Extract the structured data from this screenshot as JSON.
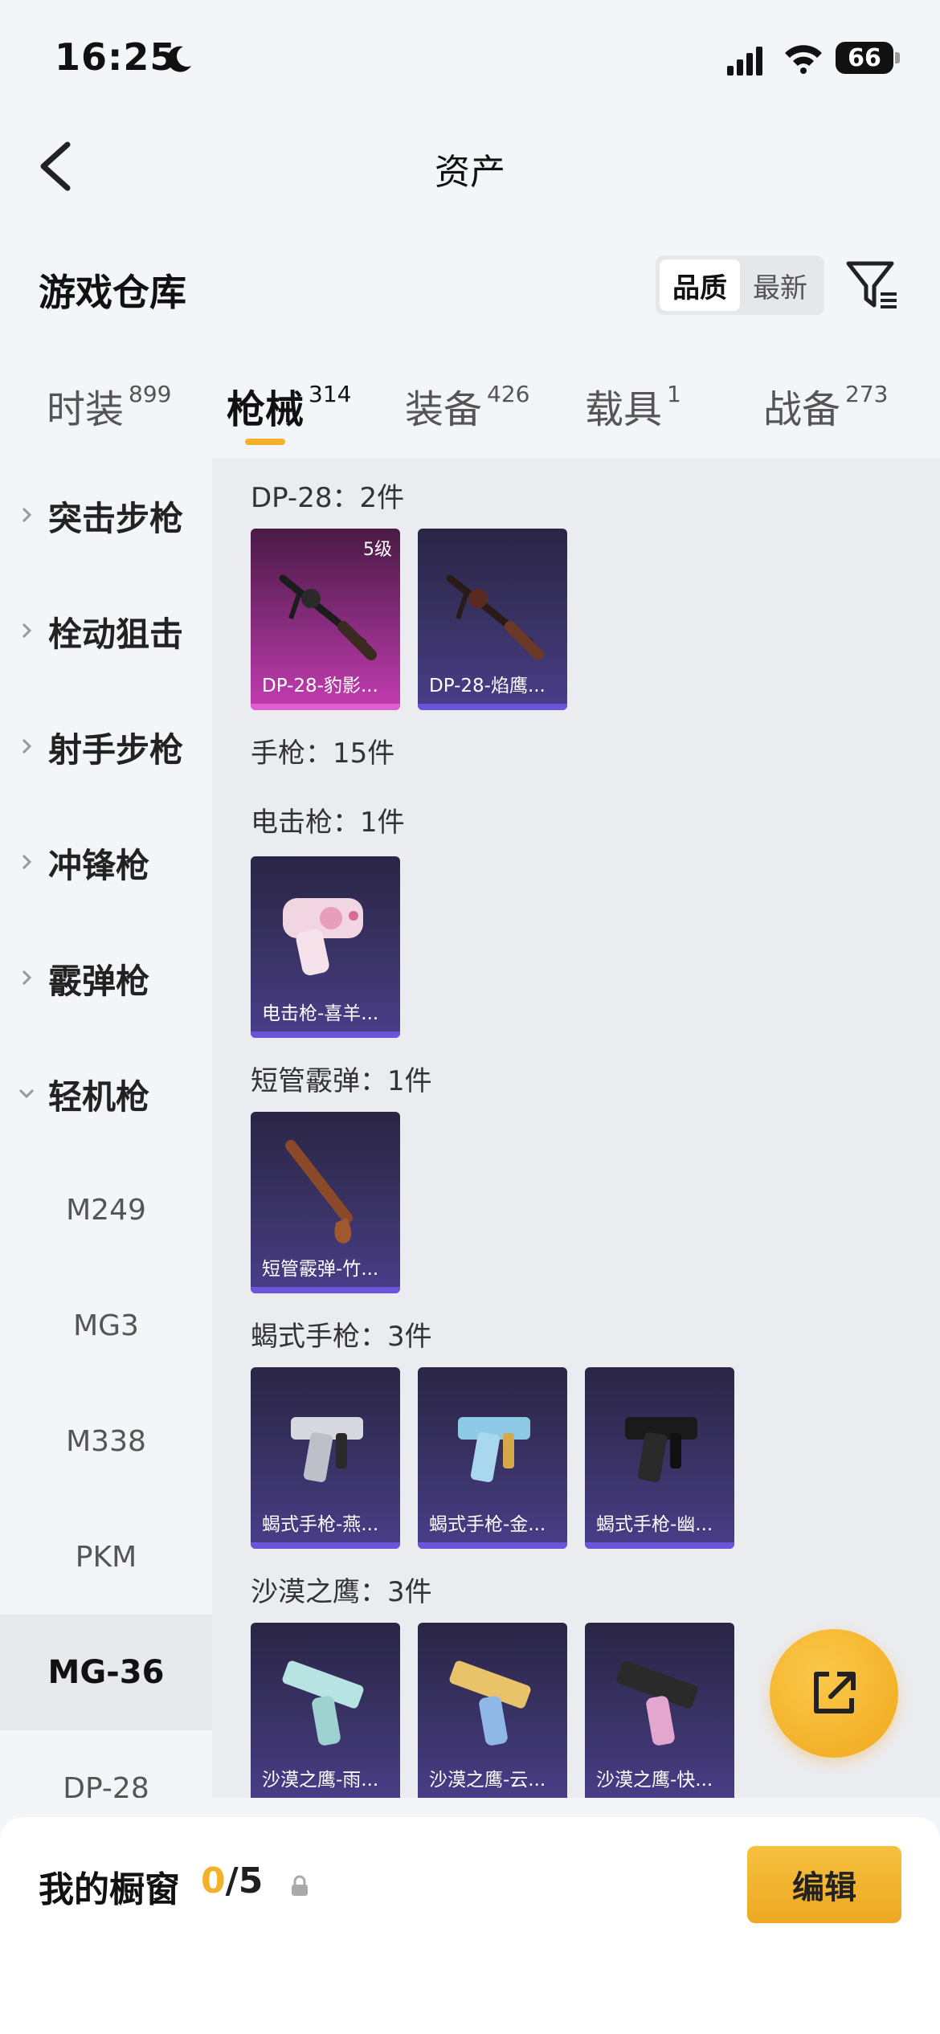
{
  "status_bar": {
    "time": "16:25",
    "battery": "66"
  },
  "header": {
    "title": "资产"
  },
  "warehouse": {
    "title": "游戏仓库",
    "sort_options": [
      "品质",
      "最新"
    ],
    "sort_active": "品质"
  },
  "tabs": [
    {
      "label": "时装",
      "count": "899"
    },
    {
      "label": "枪械",
      "count": "314"
    },
    {
      "label": "装备",
      "count": "426"
    },
    {
      "label": "载具",
      "count": "1"
    },
    {
      "label": "战备",
      "count": "273"
    }
  ],
  "active_tab": "枪械",
  "sidebar": {
    "categories": [
      "突击步枪",
      "栓动狙击",
      "射手步枪",
      "冲锋枪",
      "霰弹枪",
      "轻机枪"
    ],
    "expanded": "轻机枪",
    "subitems": [
      "M249",
      "MG3",
      "M338",
      "PKM",
      "MG-36",
      "DP-28"
    ],
    "selected": "MG-36"
  },
  "sections": [
    {
      "title": "DP-28：2件",
      "items": [
        {
          "name": "DP-28-豹影...",
          "level": "5级",
          "rarity": "gold"
        },
        {
          "name": "DP-28-焰鹰..."
        }
      ]
    },
    {
      "title": "手枪：15件",
      "items": []
    },
    {
      "title": "电击枪：1件",
      "items": [
        {
          "name": "电击枪-喜羊..."
        }
      ]
    },
    {
      "title": "短管霰弹：1件",
      "items": [
        {
          "name": "短管霰弹-竹..."
        }
      ]
    },
    {
      "title": "蝎式手枪：3件",
      "items": [
        {
          "name": "蝎式手枪-燕..."
        },
        {
          "name": "蝎式手枪-金..."
        },
        {
          "name": "蝎式手枪-幽..."
        }
      ]
    },
    {
      "title": "沙漠之鹰：3件",
      "items": [
        {
          "name": "沙漠之鹰-雨..."
        },
        {
          "name": "沙漠之鹰-云..."
        },
        {
          "name": "沙漠之鹰-快..."
        }
      ]
    }
  ],
  "showcase": {
    "label": "我的橱窗",
    "current": "0",
    "total": "/5",
    "edit_label": "编辑"
  },
  "colors": {
    "accent": "#f2b128",
    "card_purple": "#3a3366",
    "card_gold": "#c43cb2"
  }
}
